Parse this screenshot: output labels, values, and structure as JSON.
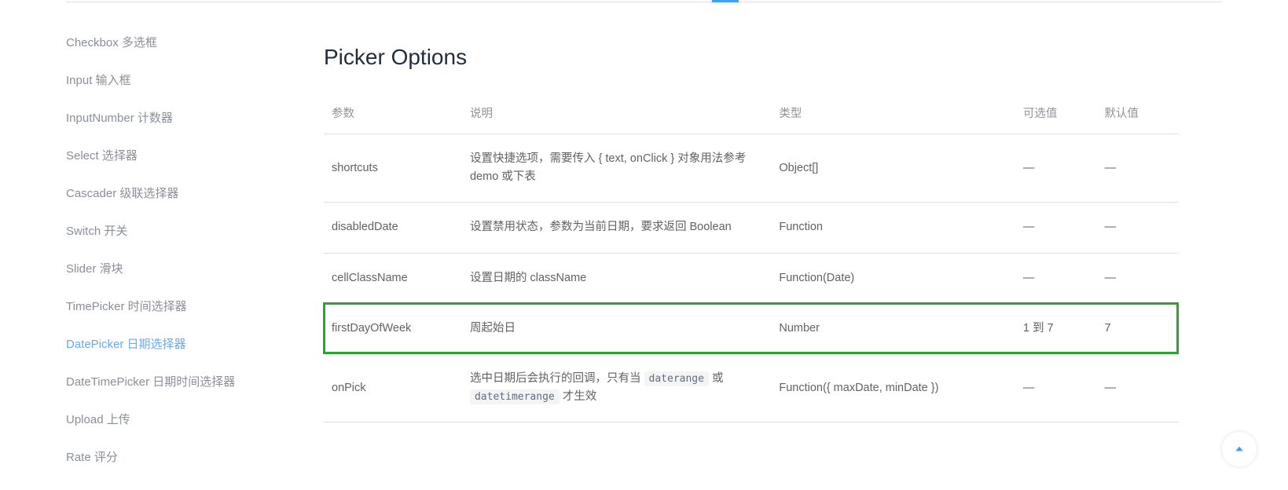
{
  "sidebar": {
    "items": [
      {
        "label": "Checkbox 多选框",
        "active": false
      },
      {
        "label": "Input 输入框",
        "active": false
      },
      {
        "label": "InputNumber 计数器",
        "active": false
      },
      {
        "label": "Select 选择器",
        "active": false
      },
      {
        "label": "Cascader 级联选择器",
        "active": false
      },
      {
        "label": "Switch 开关",
        "active": false
      },
      {
        "label": "Slider 滑块",
        "active": false
      },
      {
        "label": "TimePicker 时间选择器",
        "active": false
      },
      {
        "label": "DatePicker 日期选择器",
        "active": true
      },
      {
        "label": "DateTimePicker 日期时间选择器",
        "active": false
      },
      {
        "label": "Upload 上传",
        "active": false
      },
      {
        "label": "Rate 评分",
        "active": false
      }
    ]
  },
  "section": {
    "title": "Picker Options"
  },
  "table": {
    "headers": {
      "param": "参数",
      "desc": "说明",
      "type": "类型",
      "optional": "可选值",
      "default": "默认值"
    },
    "rows": [
      {
        "param": "shortcuts",
        "desc_plain": "设置快捷选项，需要传入 { text, onClick } 对象用法参考 demo 或下表",
        "type": "Object[]",
        "optional": "—",
        "default": "—",
        "highlight": false
      },
      {
        "param": "disabledDate",
        "desc_plain": "设置禁用状态，参数为当前日期，要求返回 Boolean",
        "type": "Function",
        "optional": "—",
        "default": "—",
        "highlight": false
      },
      {
        "param": "cellClassName",
        "desc_plain": "设置日期的 className",
        "type": "Function(Date)",
        "optional": "—",
        "default": "—",
        "highlight": false
      },
      {
        "param": "firstDayOfWeek",
        "desc_plain": "周起始日",
        "type": "Number",
        "optional": "1 到 7",
        "default": "7",
        "highlight": true
      },
      {
        "param": "onPick",
        "desc_pre": "选中日期后会执行的回调，只有当 ",
        "desc_code1": "daterange",
        "desc_mid": " 或 ",
        "desc_code2": "datetimerange",
        "desc_post": " 才生效",
        "type": "Function({ maxDate, minDate })",
        "optional": "—",
        "default": "—",
        "highlight": false,
        "has_codes": true
      }
    ]
  }
}
